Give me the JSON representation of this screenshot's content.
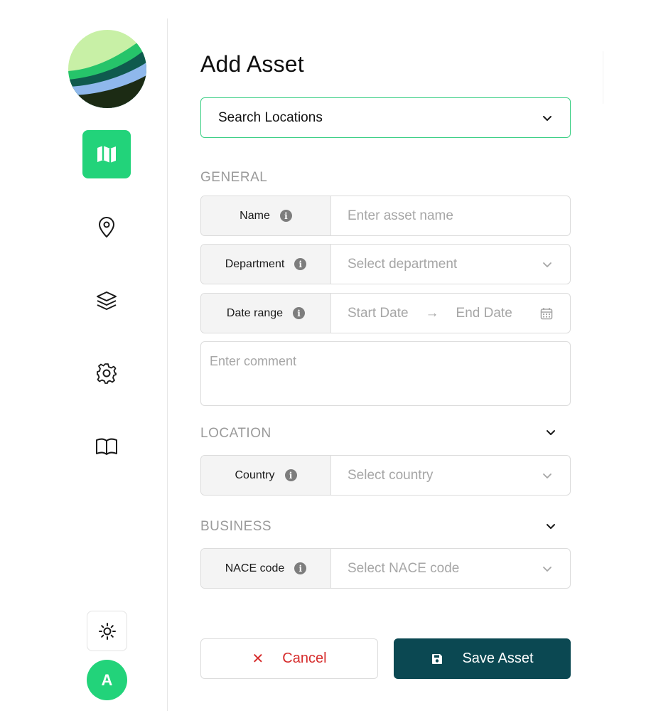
{
  "sidebar": {
    "logo": "app-logo",
    "nav": [
      {
        "name": "map",
        "icon": "map-icon",
        "active": true
      },
      {
        "name": "locations",
        "icon": "location-pin-icon",
        "active": false
      },
      {
        "name": "layers",
        "icon": "layers-icon",
        "active": false
      },
      {
        "name": "settings",
        "icon": "gear-icon",
        "active": false
      },
      {
        "name": "docs",
        "icon": "book-icon",
        "active": false
      }
    ],
    "theme_icon": "sun-icon",
    "avatar_initial": "A"
  },
  "form": {
    "title": "Add Asset",
    "search": {
      "label": "Search Locations",
      "icon": "chevron-down-icon"
    },
    "general": {
      "label": "GENERAL",
      "name": {
        "label": "Name",
        "placeholder": "Enter asset name"
      },
      "department": {
        "label": "Department",
        "placeholder": "Select department"
      },
      "date_range": {
        "label": "Date range",
        "start": "Start Date",
        "arrow": "→",
        "end": "End Date"
      },
      "comment_placeholder": "Enter comment"
    },
    "location": {
      "label": "LOCATION",
      "country": {
        "label": "Country",
        "placeholder": "Select country"
      }
    },
    "business": {
      "label": "BUSINESS",
      "nace": {
        "label": "NACE code",
        "placeholder": "Select NACE code"
      }
    },
    "actions": {
      "cancel_icon": "✕",
      "cancel": "Cancel",
      "save": "Save Asset"
    }
  },
  "colors": {
    "accent": "#22d37a",
    "primary": "#0b4852",
    "danger": "#d62c2c",
    "search_border": "#3ccf85"
  }
}
